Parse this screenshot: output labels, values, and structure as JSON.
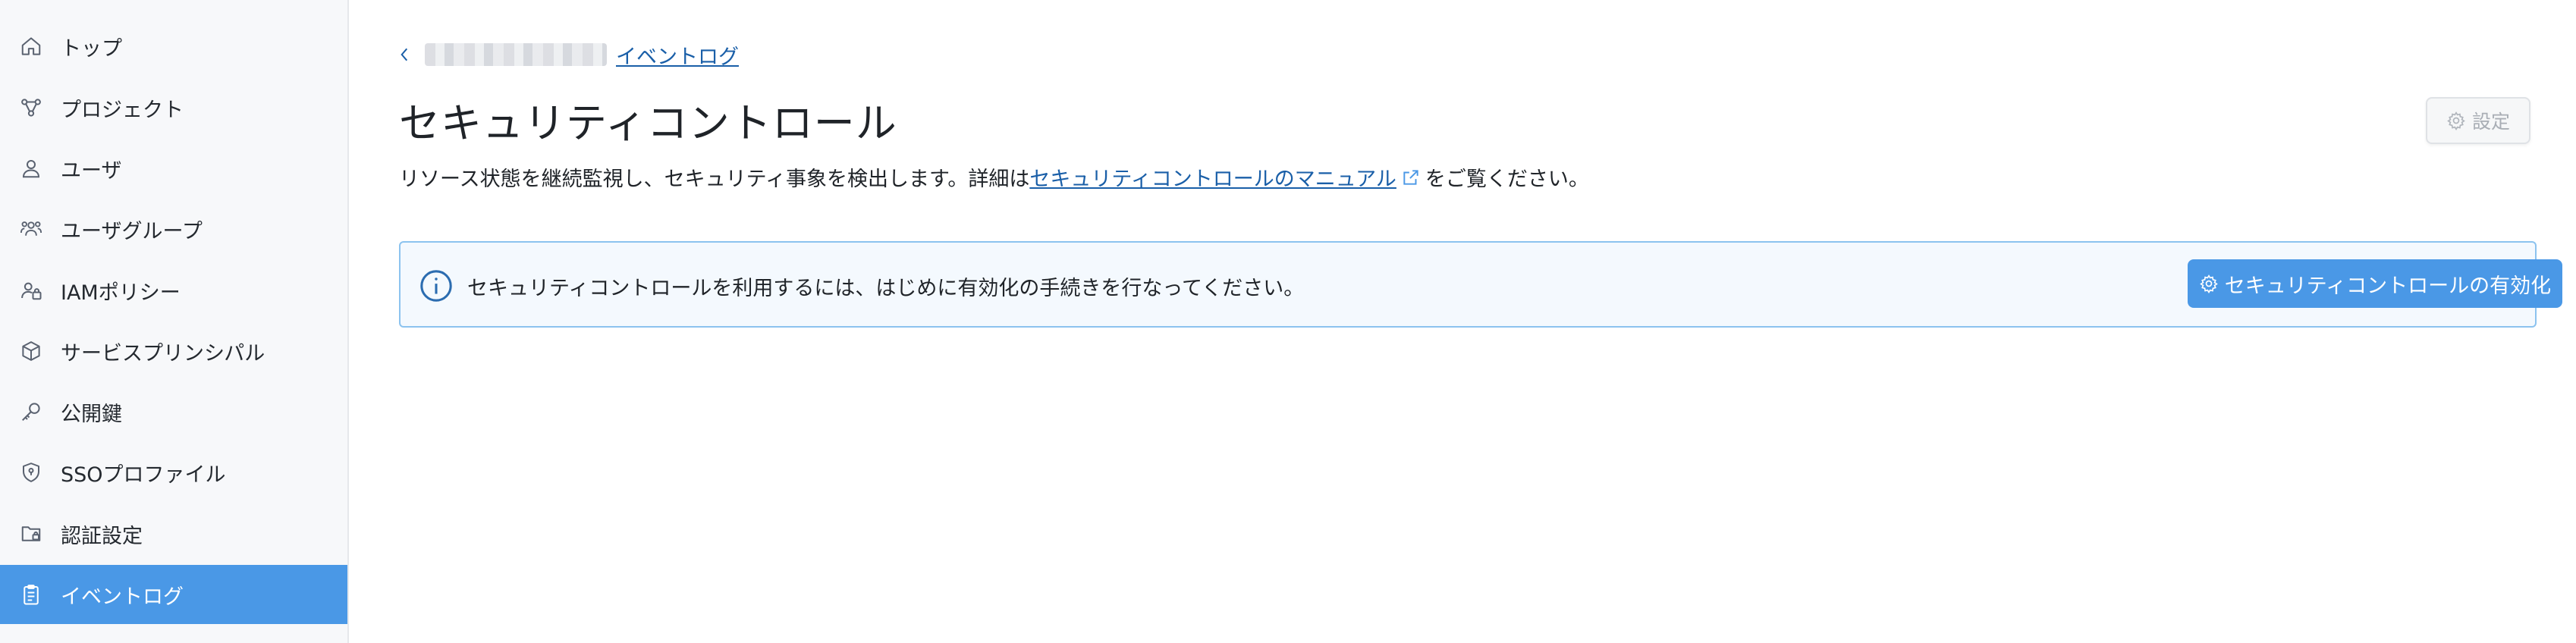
{
  "sidebar": {
    "items": [
      {
        "label": "トップ",
        "icon": "home-icon"
      },
      {
        "label": "プロジェクト",
        "icon": "project-icon"
      },
      {
        "label": "ユーザ",
        "icon": "user-icon"
      },
      {
        "label": "ユーザグループ",
        "icon": "user-group-icon"
      },
      {
        "label": "IAMポリシー",
        "icon": "iam-policy-icon"
      },
      {
        "label": "サービスプリンシパル",
        "icon": "service-principal-icon"
      },
      {
        "label": "公開鍵",
        "icon": "key-icon"
      },
      {
        "label": "SSOプロファイル",
        "icon": "shield-icon"
      },
      {
        "label": "認証設定",
        "icon": "auth-settings-icon"
      },
      {
        "label": "イベントログ",
        "icon": "clipboard-icon",
        "active": true
      }
    ]
  },
  "breadcrumb": {
    "parent_link": "イベントログ"
  },
  "page": {
    "title": "セキュリティコントロール",
    "settings_label": "設定",
    "description_prefix": "リソース状態を継続監視し、セキュリティ事象を検出します。詳細は",
    "description_link": "セキュリティコントロールのマニュアル",
    "description_suffix": "をご覧ください。"
  },
  "banner": {
    "message": "セキュリティコントロールを利用するには、はじめに有効化の手続きを行なってください。",
    "enable_button_label": "セキュリティコントロールの有効化"
  },
  "colors": {
    "accent": "#4a98e6",
    "link": "#1a5fa8",
    "banner_border": "#8cc3ef",
    "banner_bg": "#f4f9fe"
  }
}
